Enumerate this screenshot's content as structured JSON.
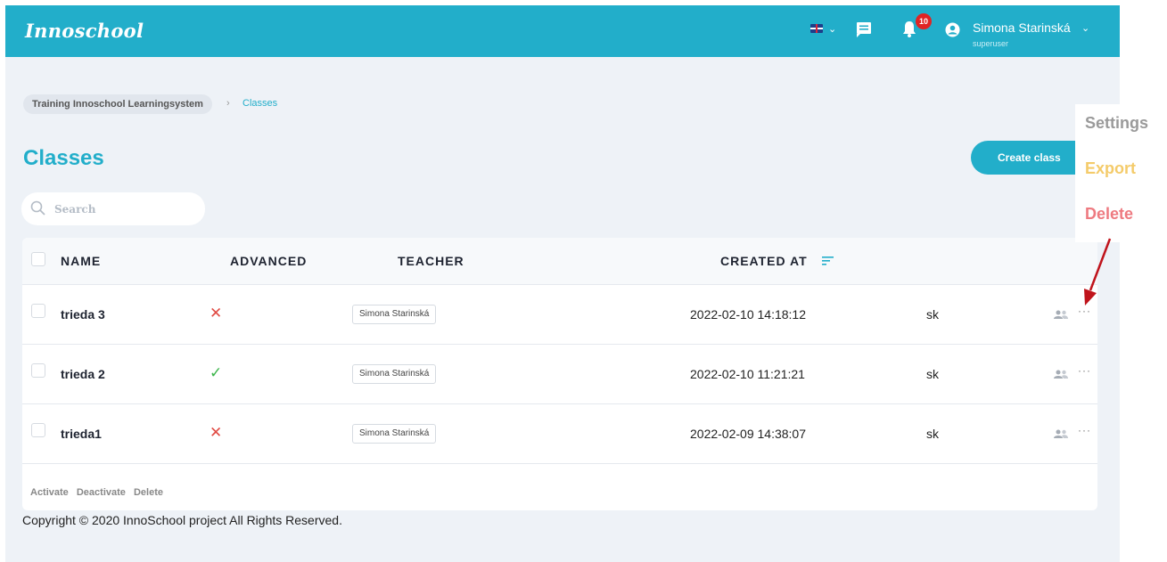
{
  "header": {
    "logo": "Innoschool",
    "notification_count": "10",
    "user_name": "Simona Starinská",
    "user_role": "superuser",
    "brand_color": "#22aeca"
  },
  "breadcrumb": {
    "root": "Training Innoschool Learningsystem",
    "separator": "›",
    "current": "Classes"
  },
  "page": {
    "title": "Classes",
    "create_button": "Create class",
    "search_placeholder": "Search"
  },
  "table": {
    "columns": [
      "NAME",
      "ADVANCED",
      "TEACHER",
      "CREATED AT"
    ],
    "rows": [
      {
        "name": "trieda 3",
        "advanced": "✕",
        "teacher": "Simona Starinská",
        "created": "2022-02-10 14:18:12",
        "lang": "sk"
      },
      {
        "name": "trieda 2",
        "advanced": "✓",
        "teacher": "Simona Starinská",
        "created": "2022-02-10 11:21:21",
        "lang": "sk"
      },
      {
        "name": "trieda1",
        "advanced": "✕",
        "teacher": "Simona Starinská",
        "created": "2022-02-09 14:38:07",
        "lang": "sk"
      }
    ],
    "bulk_actions": [
      "Activate",
      "Deactivate",
      "Delete"
    ]
  },
  "footer": {
    "copyright": "Copyright © 2020 InnoSchool project All Rights Reserved."
  },
  "context_menu": {
    "items": [
      "Settings",
      "Export",
      "Delete"
    ]
  }
}
